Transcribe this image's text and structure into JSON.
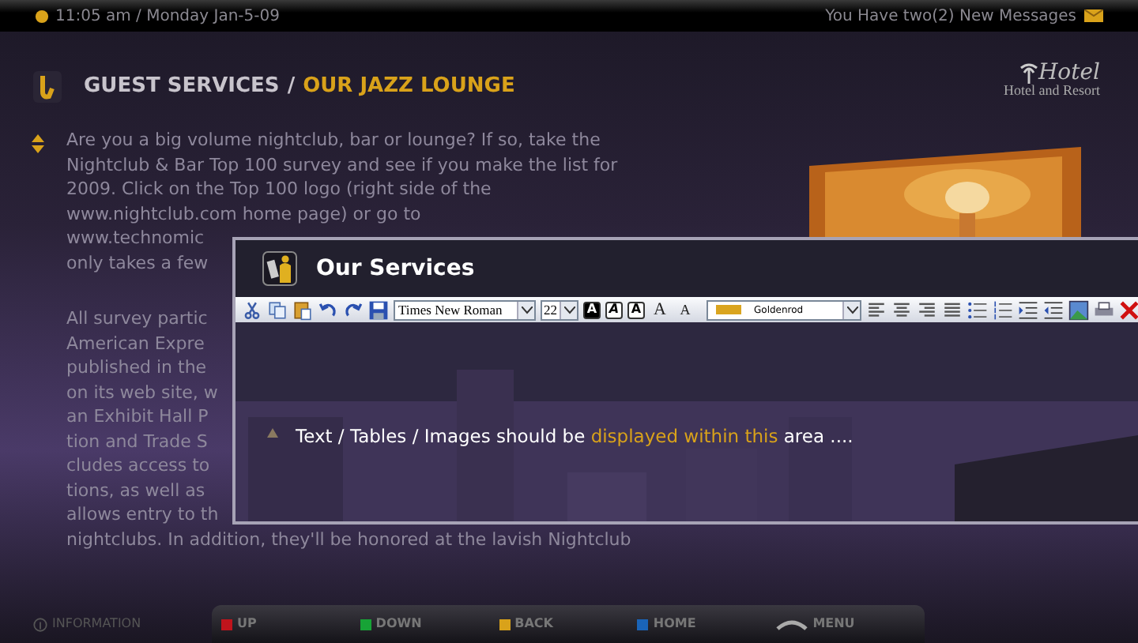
{
  "top_bar": {
    "datetime": "11:05 am / Monday Jan-5-09",
    "messages": "You Have two(2) New Messages"
  },
  "header": {
    "section": "GUEST SERVICES",
    "separator": "/",
    "page": "OUR JAZZ LOUNGE",
    "logo_script": "Hotel",
    "logo_sub": "Hotel and Resort"
  },
  "article": {
    "paragraphs": [
      [
        "Are you a big volume nightclub, bar or lounge? If so, take the",
        "Nightclub & Bar Top 100 survey and see if you make the list for",
        "2009. Click on the Top 100 logo (right side of the",
        "www.nightclub.com home page) or go to",
        "www.technomic",
        "only takes a few"
      ],
      [
        "All survey partic",
        "American Expre",
        "published in the",
        "on its web site, w",
        "an Exhibit Hall P",
        "tion and Trade S",
        "cludes access to",
        "tions, as well as",
        "allows entry to th",
        "nightclubs. In addition, they'll be honored at the lavish Nightclub"
      ]
    ]
  },
  "dialog": {
    "title": "Our Services",
    "toolbar": {
      "font": "Times New Roman",
      "size": "22",
      "style_buttons": [
        "A",
        "A",
        "A"
      ],
      "size_buttons": [
        "A",
        "A"
      ],
      "color": {
        "name": "Goldenrod",
        "color": "#daa520"
      }
    },
    "message": [
      {
        "text": "Text / Tables / Images should be ",
        "highlight": false
      },
      {
        "text": "displayed  within this",
        "highlight": true
      },
      {
        "text": " area ....",
        "highlight": false
      }
    ]
  },
  "bottom_bar": {
    "info": "INFORMATION",
    "buttons": [
      {
        "label": "UP",
        "color": "#c0141c"
      },
      {
        "label": "DOWN",
        "color": "#17a336"
      },
      {
        "label": "BACK",
        "color": "#d9a21a"
      },
      {
        "label": "HOME",
        "color": "#1a64b8"
      },
      {
        "label": "MENU",
        "kind": "remote"
      }
    ]
  }
}
